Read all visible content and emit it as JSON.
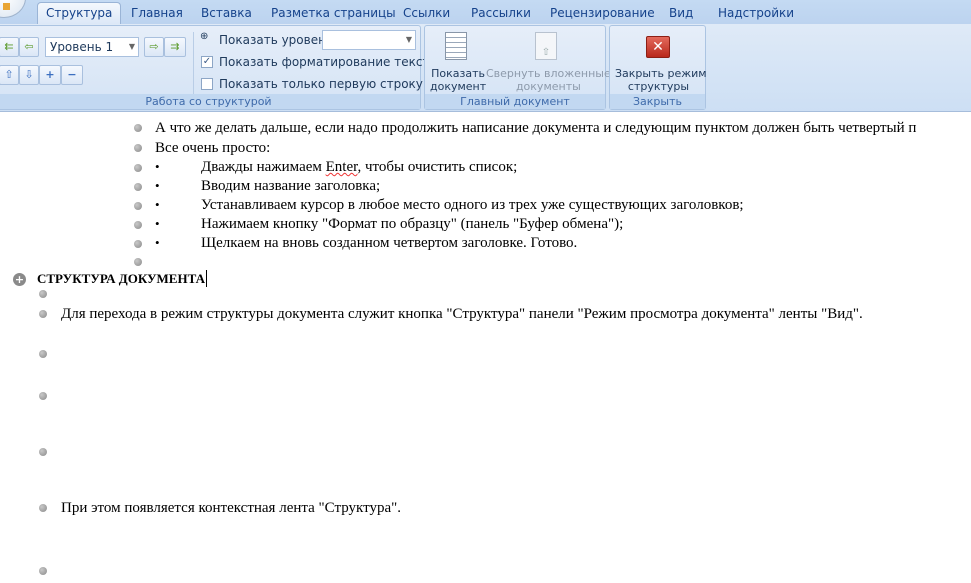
{
  "tabs": [
    "Структура",
    "Главная",
    "Вставка",
    "Разметка страницы",
    "Ссылки",
    "Рассылки",
    "Рецензирование",
    "Вид",
    "Надстройки"
  ],
  "outline_group": {
    "level_value": "Уровень 1",
    "show_level_label": "Показать уровень:",
    "show_level_value": "",
    "show_formatting_label": "Показать форматирование текста",
    "show_formatting_checked": true,
    "first_line_only_label": "Показать только первую строку",
    "first_line_only_checked": false,
    "label": "Работа со структурой"
  },
  "master_group": {
    "show_doc_1": "Показать",
    "show_doc_2": "документ",
    "collapse_1": "Свернуть вложенные",
    "collapse_2": "документы",
    "label": "Главный документ"
  },
  "close_group": {
    "close_1": "Закрыть режим",
    "close_2": "структуры",
    "label": "Закрыть"
  },
  "document": {
    "level3": [
      "А что же делать дальше, если надо продолжить написание документа и следующим пунктом должен быть четвертый п",
      "Все очень просто:"
    ],
    "bullets_pre": "Дважды нажимаем ",
    "bullets_enter": "Enter",
    "bullets_post": ", чтобы очистить список;",
    "bullets": [
      "Вводим название заголовка;",
      "Устанавливаем курсор в любое место одного из трех уже существующих заголовков;",
      "Нажимаем кнопку \"Формат по образцу\" (панель \"Буфер обмена\");",
      "Щелкаем на вновь созданном четвертом заголовке. Готово."
    ],
    "heading": "СТРУКТУРА ДОКУМЕНТА",
    "para1": "Для перехода в режим структуры документа служит кнопка \"Структура\" панели \"Режим просмотра документа\" ленты \"Вид\".",
    "para2": "При этом появляется контекстная лента \"Структура\"."
  }
}
